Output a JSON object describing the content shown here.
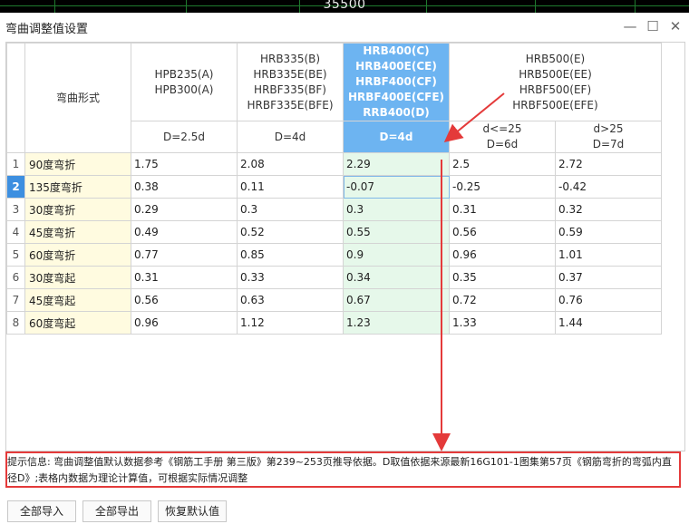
{
  "background_bar": {
    "text": "35500"
  },
  "dialog": {
    "title": "弯曲调整值设置",
    "controls": {
      "minimize": "—",
      "maximize": "☐",
      "close": "✕"
    }
  },
  "table": {
    "corner_header": "弯曲形式",
    "groups": [
      {
        "lines": [
          "HPB235(A)",
          "HPB300(A)"
        ],
        "subheaders": [
          "D=2.5d"
        ]
      },
      {
        "lines": [
          "HRB335(B)",
          "HRB335E(BE)",
          "HRBF335(BF)",
          "HRBF335E(BFE)"
        ],
        "subheaders": [
          "D=4d"
        ]
      },
      {
        "lines": [
          "HRB400(C)",
          "HRB400E(CE)",
          "HRBF400(CF)",
          "HRBF400E(CFE)",
          "RRB400(D)"
        ],
        "subheaders": [
          "D=4d"
        ]
      },
      {
        "lines": [
          "HRB500(E)",
          "HRB500E(EE)",
          "HRBF500(EF)",
          "HRBF500E(EFE)"
        ],
        "subheaders": [
          [
            "d<=25",
            "D=6d"
          ],
          [
            "d>25",
            "D=7d"
          ]
        ]
      }
    ],
    "selected_column": 2,
    "selected_row": 1,
    "rows": [
      {
        "num": "1",
        "type": "90度弯折",
        "values": [
          "1.75",
          "2.08",
          "2.29",
          "2.5",
          "2.72"
        ]
      },
      {
        "num": "2",
        "type": "135度弯折",
        "values": [
          "0.38",
          "0.11",
          "-0.07",
          "-0.25",
          "-0.42"
        ]
      },
      {
        "num": "3",
        "type": "30度弯折",
        "values": [
          "0.29",
          "0.3",
          "0.3",
          "0.31",
          "0.32"
        ]
      },
      {
        "num": "4",
        "type": "45度弯折",
        "values": [
          "0.49",
          "0.52",
          "0.55",
          "0.56",
          "0.59"
        ]
      },
      {
        "num": "5",
        "type": "60度弯折",
        "values": [
          "0.77",
          "0.85",
          "0.9",
          "0.96",
          "1.01"
        ]
      },
      {
        "num": "6",
        "type": "30度弯起",
        "values": [
          "0.31",
          "0.33",
          "0.34",
          "0.35",
          "0.37"
        ]
      },
      {
        "num": "7",
        "type": "45度弯起",
        "values": [
          "0.56",
          "0.63",
          "0.67",
          "0.72",
          "0.76"
        ]
      },
      {
        "num": "8",
        "type": "60度弯起",
        "values": [
          "0.96",
          "1.12",
          "1.23",
          "1.33",
          "1.44"
        ]
      }
    ]
  },
  "info": {
    "text": "提示信息: 弯曲调整值默认数据参考《钢筋工手册 第三版》第239~253页推导依据。D取值依据来源最新16G101-1图集第57页《钢筋弯折的弯弧内直径D》;表格内数据为理论计算值，可根据实际情况调整"
  },
  "buttons": {
    "import_all": "全部导入",
    "export_all": "全部导出",
    "restore_default": "恢复默认值"
  },
  "colors": {
    "header_highlight": "#6db4f1",
    "type_column_bg": "#fffbe0",
    "selected_column_bg": "#e6f8ea",
    "annotation_red": "#e43a3a"
  }
}
